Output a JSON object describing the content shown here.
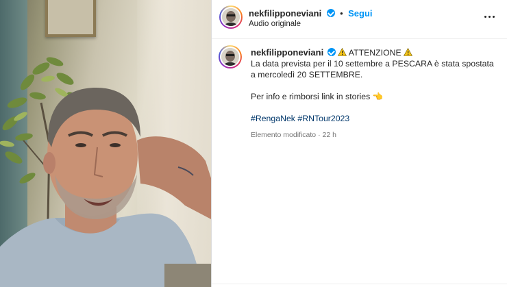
{
  "media": {
    "description_icon": "video-frame"
  },
  "header": {
    "username": "nekfilipponeviani",
    "separator": "•",
    "follow_label": "Segui",
    "audio_label": "Audio originale",
    "more_icon": "more-horizontal-icon"
  },
  "caption": {
    "username": "nekfilipponeviani",
    "attention": "ATTENZIONE",
    "line1": "La data prevista per il 10 settembre a PESCARA è stata spostata a mercoledì 20 SETTEMBRE.",
    "line2": "Per info e rimborsi link in stories 👈",
    "hashtags": "#RengaNek #RNTour2023",
    "edited_label": "Elemento modificato",
    "meta_separator": "·",
    "time_ago": "22 h"
  },
  "colors": {
    "accent": "#0095f6",
    "hashtag": "#00376b",
    "muted": "#737373",
    "warning": "#f5c518"
  }
}
